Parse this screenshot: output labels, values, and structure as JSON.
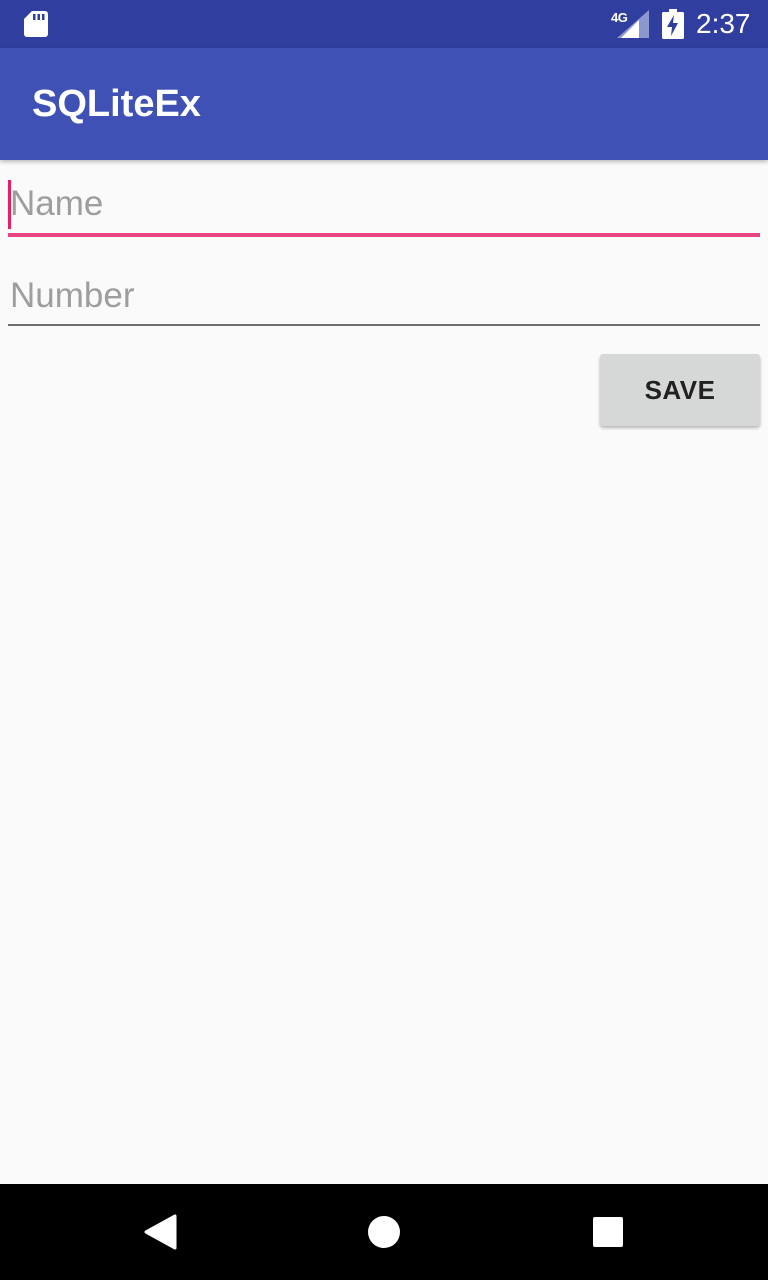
{
  "status_bar": {
    "network": "4G",
    "time": "2:37",
    "icons": [
      "sd-card-icon",
      "signal-icon",
      "battery-charging-icon"
    ]
  },
  "app_bar": {
    "title": "SQLiteEx"
  },
  "form": {
    "name_field": {
      "placeholder": "Name",
      "value": ""
    },
    "number_field": {
      "placeholder": "Number",
      "value": ""
    },
    "save_label": "SAVE"
  },
  "nav_bar": {
    "icons": [
      "back-icon",
      "home-icon",
      "recents-icon"
    ]
  },
  "colors": {
    "status_bar": "#303f9f",
    "primary": "#3f51b5",
    "accent": "#e91e63",
    "background": "#fafafa",
    "button": "#d6d7d7"
  }
}
